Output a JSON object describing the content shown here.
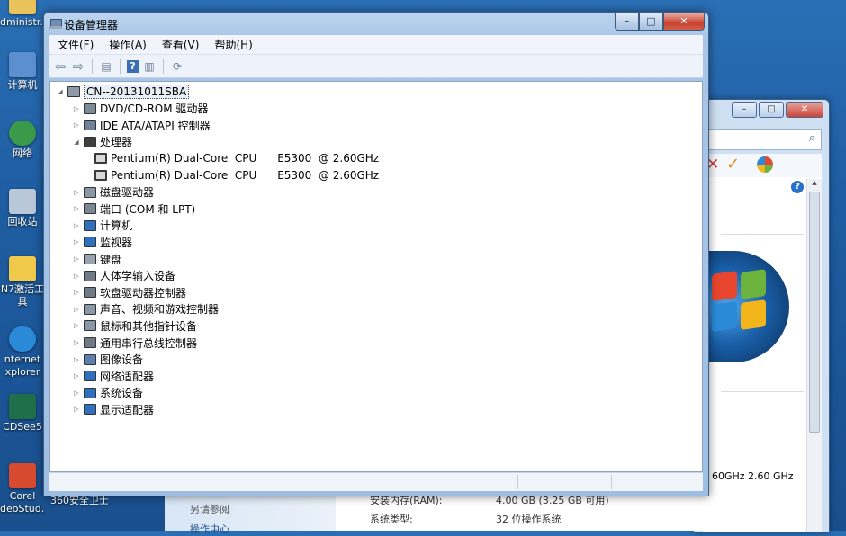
{
  "desktop": {
    "icons": [
      {
        "label": "dministr...",
        "icon": "user-folder-icon"
      },
      {
        "label": "计算机",
        "icon": "computer-icon"
      },
      {
        "label": "网络",
        "icon": "network-icon"
      },
      {
        "label": "回收站",
        "icon": "recycle-bin-icon"
      },
      {
        "label": "N7激活工",
        "label2": "具",
        "icon": "folder-icon"
      },
      {
        "label": "nternet",
        "label2": "xplorer",
        "icon": "ie-icon"
      },
      {
        "label": "CDSee5",
        "icon": "acdsee-icon"
      },
      {
        "label": "Corel",
        "label2": "deoStud...",
        "icon": "corel-icon"
      }
    ],
    "taskbar_partial": "360安全卫士"
  },
  "background_window": {
    "cpu_speed": "60GHz",
    "cpu_speed2": "2.60 GHz",
    "ram_label": "安装内存(RAM):",
    "ram_value": "4.00 GB (3.25 GB 可用)",
    "system_type_label": "系统类型:",
    "system_type_value": "32 位操作系统",
    "see_also": "另请参阅",
    "action_center": "操作中心"
  },
  "device_manager": {
    "title": "设备管理器",
    "title_icon": "device-manager-icon",
    "caption_buttons": {
      "minimize": "–",
      "maximize": "□",
      "close": "✕"
    },
    "menu": [
      "文件(F)",
      "操作(A)",
      "查看(V)",
      "帮助(H)"
    ],
    "toolbar": [
      {
        "name": "back-icon",
        "glyph": "⇦"
      },
      {
        "name": "forward-icon",
        "glyph": "⇨"
      },
      {
        "name": "properties-view-icon",
        "glyph": "▤"
      },
      {
        "name": "help-icon",
        "glyph": "?"
      },
      {
        "name": "show-hidden-icon",
        "glyph": "▥"
      },
      {
        "name": "scan-hardware-icon",
        "glyph": "⟳"
      }
    ],
    "tree": {
      "root": "CN--20131011SBA",
      "categories": [
        {
          "label": "DVD/CD-ROM 驱动器",
          "icon": "dvd-drive-icon",
          "expanded": false
        },
        {
          "label": "IDE ATA/ATAPI 控制器",
          "icon": "ide-controller-icon",
          "expanded": false
        },
        {
          "label": "处理器",
          "icon": "processor-icon",
          "expanded": true,
          "children": [
            "Pentium(R) Dual-Core  CPU      E5300  @ 2.60GHz",
            "Pentium(R) Dual-Core  CPU      E5300  @ 2.60GHz"
          ]
        },
        {
          "label": "磁盘驱动器",
          "icon": "disk-drive-icon",
          "expanded": false
        },
        {
          "label": "端口 (COM 和 LPT)",
          "icon": "port-icon",
          "expanded": false
        },
        {
          "label": "计算机",
          "icon": "computer-icon",
          "expanded": false
        },
        {
          "label": "监视器",
          "icon": "monitor-icon",
          "expanded": false
        },
        {
          "label": "键盘",
          "icon": "keyboard-icon",
          "expanded": false
        },
        {
          "label": "人体学输入设备",
          "icon": "hid-icon",
          "expanded": false
        },
        {
          "label": "软盘驱动器控制器",
          "icon": "floppy-controller-icon",
          "expanded": false
        },
        {
          "label": "声音、视频和游戏控制器",
          "icon": "sound-icon",
          "expanded": false
        },
        {
          "label": "鼠标和其他指针设备",
          "icon": "mouse-icon",
          "expanded": false
        },
        {
          "label": "通用串行总线控制器",
          "icon": "usb-icon",
          "expanded": false
        },
        {
          "label": "图像设备",
          "icon": "imaging-device-icon",
          "expanded": false
        },
        {
          "label": "网络适配器",
          "icon": "network-adapter-icon",
          "expanded": false
        },
        {
          "label": "系统设备",
          "icon": "system-device-icon",
          "expanded": false
        },
        {
          "label": "显示适配器",
          "icon": "display-adapter-icon",
          "expanded": false
        }
      ]
    }
  }
}
